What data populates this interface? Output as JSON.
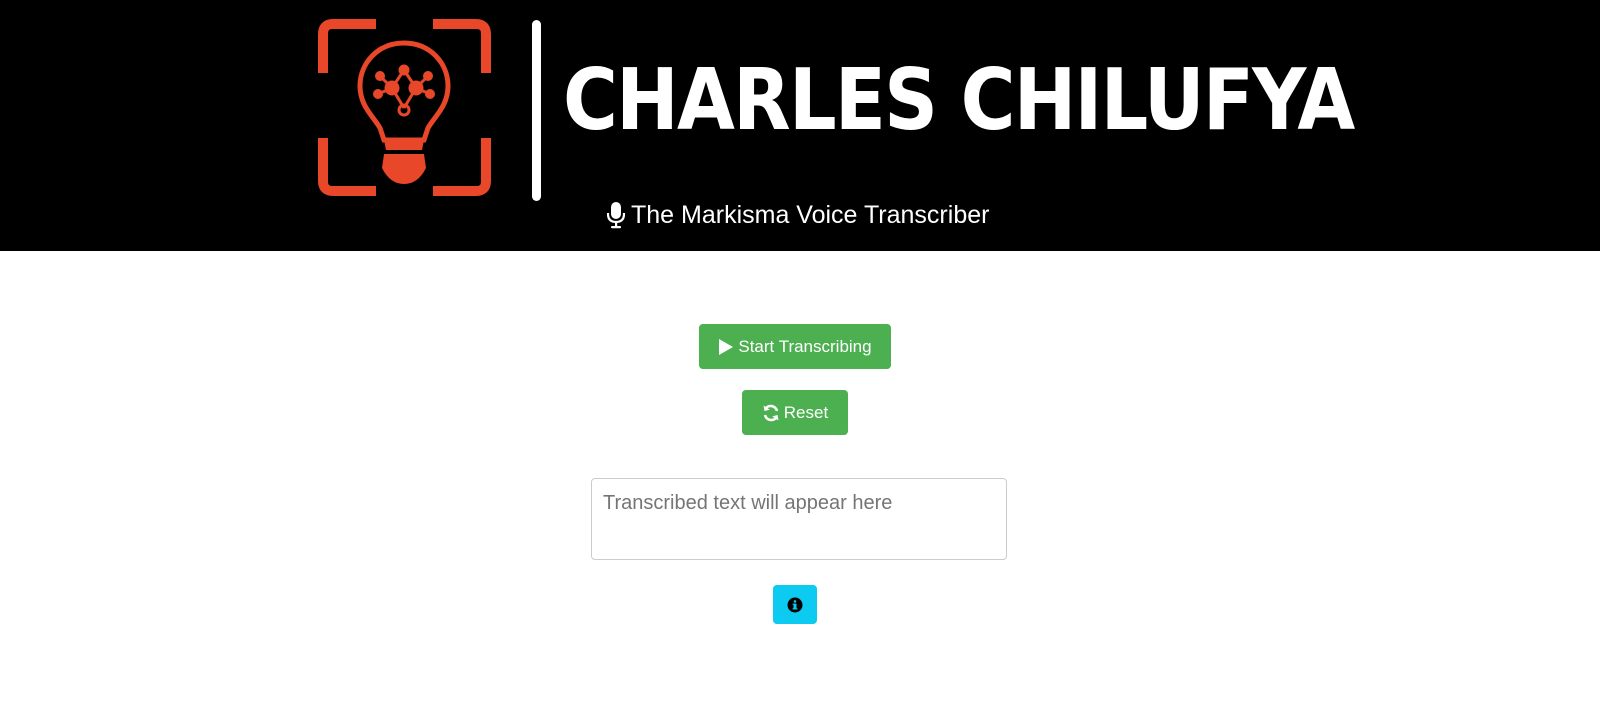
{
  "header": {
    "brand_name": "CHARLES CHILUFYA",
    "subtitle": "The Markisma Voice Transcriber",
    "logo_icon": "lightbulb-network-icon",
    "brand_color": "#e8472a",
    "background": "#000000"
  },
  "controls": {
    "start_label": "Start Transcribing",
    "start_icon": "play-icon",
    "reset_label": "Reset",
    "reset_icon": "refresh-icon",
    "button_color": "#4caf50"
  },
  "transcript": {
    "value": "",
    "placeholder": "Transcribed text will appear here"
  },
  "info": {
    "icon": "info-icon",
    "color": "#0dcaf0"
  }
}
